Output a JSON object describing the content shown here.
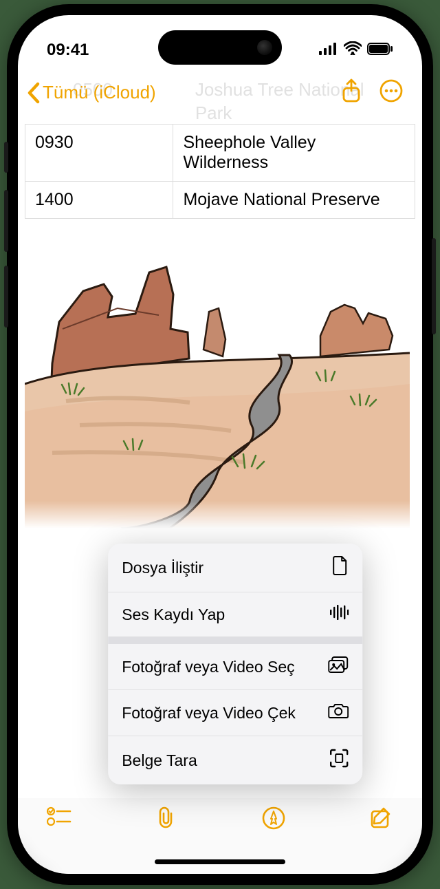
{
  "status": {
    "time": "09:41"
  },
  "nav": {
    "back_label": "Tümü (iCloud)"
  },
  "background_row": {
    "time": "0500",
    "place": "Joshua Tree National Park"
  },
  "table": {
    "rows": [
      {
        "time": "0930",
        "place": "Sheephole Valley Wilderness"
      },
      {
        "time": "1400",
        "place": "Mojave National Preserve"
      }
    ]
  },
  "popup": {
    "items_a": [
      {
        "label": "Dosya İliştir",
        "icon": "document-icon"
      },
      {
        "label": "Ses Kaydı Yap",
        "icon": "waveform-icon"
      }
    ],
    "items_b": [
      {
        "label": "Fotoğraf veya Video Seç",
        "icon": "gallery-icon"
      },
      {
        "label": "Fotoğraf veya Video Çek",
        "icon": "camera-icon"
      },
      {
        "label": "Belge Tara",
        "icon": "scan-icon"
      }
    ]
  },
  "colors": {
    "accent": "#f0a400"
  }
}
